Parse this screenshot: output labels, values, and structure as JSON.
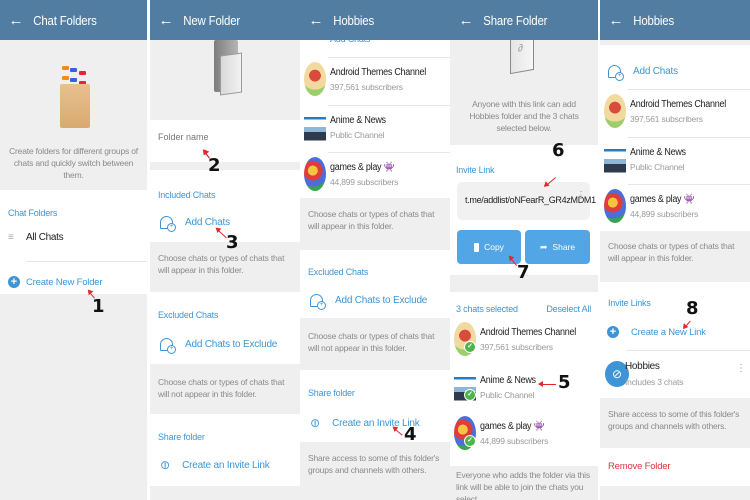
{
  "colors": {
    "header": "#527da3",
    "accent": "#3d95d6",
    "danger": "#d9363e",
    "button": "#52a6e6",
    "check": "#4cb64c"
  },
  "panel1": {
    "title": "Chat Folders",
    "back_icon": "arrow-left-icon",
    "intro": "Create folders for different groups of chats and quickly switch between them.",
    "section_title": "Chat Folders",
    "all_chats": "All Chats",
    "create_new_folder": "Create New Folder",
    "annotation": "1"
  },
  "panel2": {
    "title": "New Folder",
    "folder_name_placeholder": "Folder name",
    "folder_name_value": "",
    "included_title": "Included Chats",
    "add_chats": "Add Chats",
    "included_hint": "Choose chats or types of chats that will appear in this folder.",
    "excluded_title": "Excluded Chats",
    "add_excluded": "Add Chats to Exclude",
    "excluded_hint": "Choose chats or types of chats that will not appear in this folder.",
    "share_title": "Share folder",
    "create_invite": "Create an Invite Link",
    "annotations": [
      "2",
      "3"
    ]
  },
  "chats": [
    {
      "name": "Android Themes Channel",
      "sub": "397,561 subscribers",
      "emoji": ""
    },
    {
      "name": "Anime & News",
      "sub": "Public Channel",
      "emoji": ""
    },
    {
      "name": "games & play",
      "sub": "44,899 subscribers",
      "emoji": "👾"
    }
  ],
  "panel3": {
    "title": "Hobbies",
    "partial_top": "Add Chats",
    "included_hint": "Choose chats or types of chats that will appear in this folder.",
    "excluded_title": "Excluded Chats",
    "add_excluded": "Add Chats to Exclude",
    "excluded_hint": "Choose chats or types of chats that will not appear in this folder.",
    "share_title": "Share folder",
    "create_invite": "Create an Invite Link",
    "share_hint": "Share access to some of this folder's groups and channels with others.",
    "annotation": "4"
  },
  "panel4": {
    "title": "Share Folder",
    "intro": "Anyone with this link can add Hobbies folder and the 3 chats selected below.",
    "invite_title": "Invite Link",
    "link": "t.me/addlist/oNFearR_GR4zMDM1",
    "copy": "Copy",
    "share": "Share",
    "selected_count": "3 chats selected",
    "deselect_all": "Deselect All",
    "footer_hint": "Everyone who adds the folder via this link will be able to join the chats you select.",
    "annotations": [
      "6",
      "7",
      "5"
    ]
  },
  "panel5": {
    "title": "Hobbies",
    "add_chats": "Add Chats",
    "included_hint": "Choose chats or types of chats that will appear in this folder.",
    "invite_links_title": "Invite Links",
    "create_new_link": "Create a New Link",
    "link_name": "Hobbies",
    "link_sub": "Includes 3 chats",
    "share_hint": "Share access to some of this folder's groups and channels with others.",
    "remove_folder": "Remove Folder",
    "annotation": "8"
  }
}
